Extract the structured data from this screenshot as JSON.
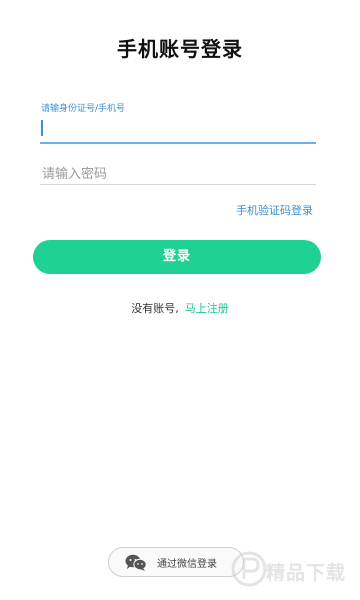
{
  "header": {
    "title": "手机账号登录"
  },
  "form": {
    "account_label": "请输身份证号/手机号",
    "account_value": "",
    "password_placeholder": "请输入密码",
    "sms_login_label": "手机验证码登录",
    "login_button_label": "登录",
    "no_account_text": "没有账号,",
    "register_label": "马上注册"
  },
  "wechat": {
    "label": "通过微信登录",
    "icon": "wechat-icon"
  },
  "watermark": {
    "text": "精品下载"
  },
  "colors": {
    "accent_green": "#1fd192",
    "link_blue": "#3d8fd6",
    "input_focus": "#6ab0e6"
  }
}
